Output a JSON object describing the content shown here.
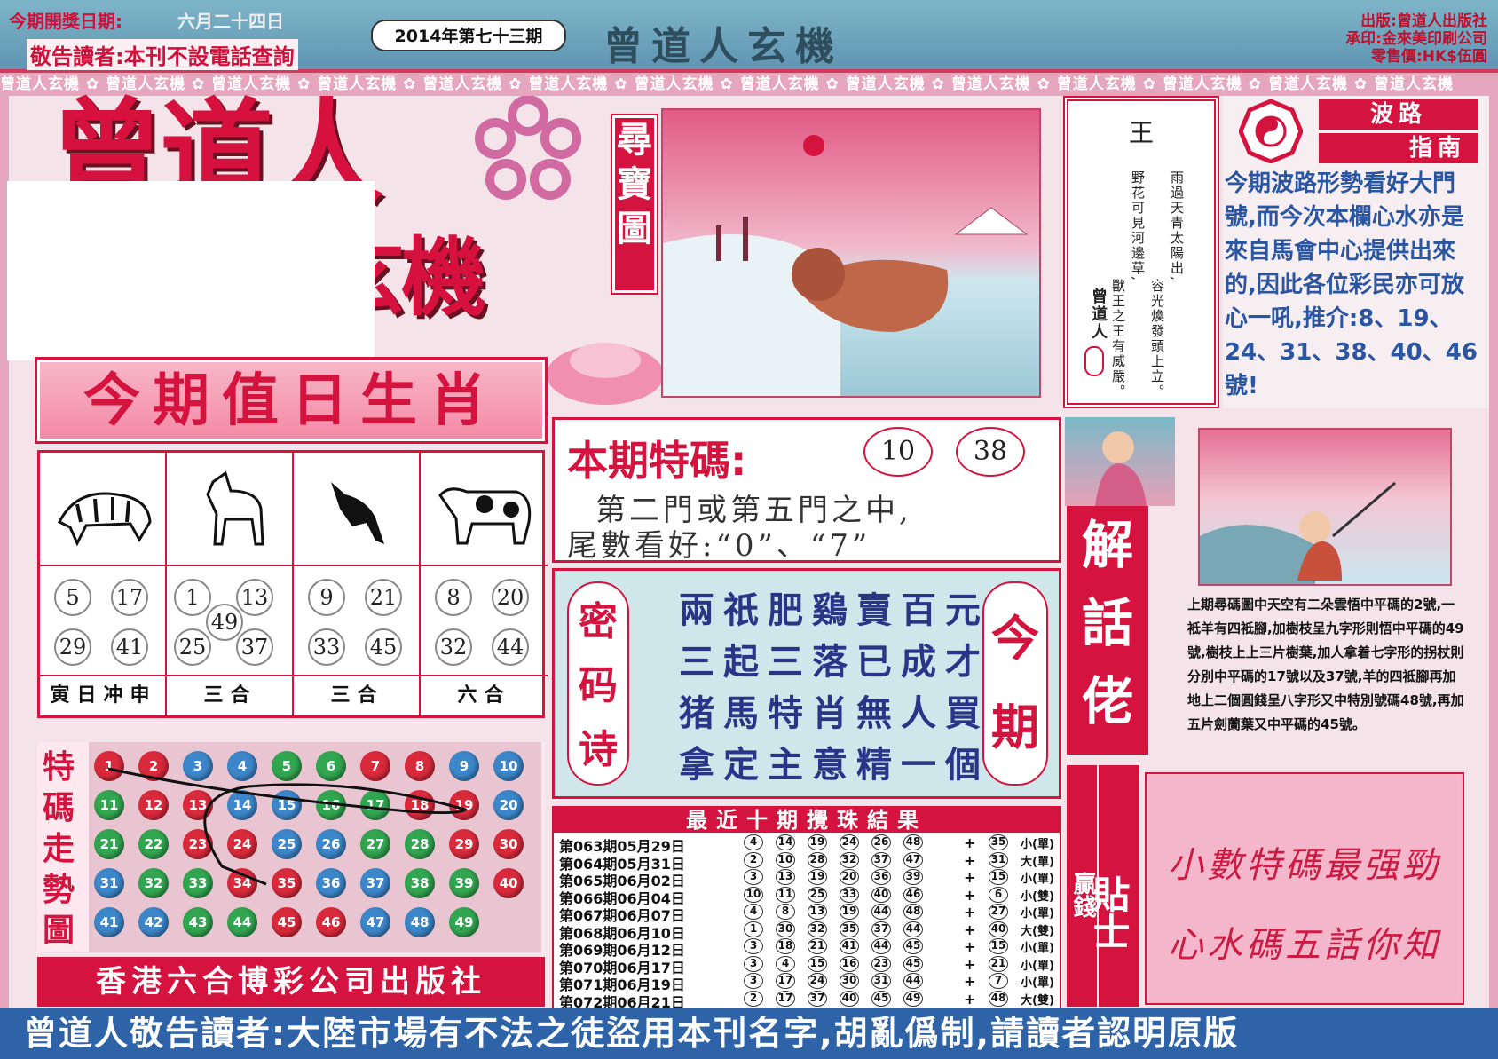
{
  "header": {
    "draw_date_label": "今期開獎日期:",
    "draw_date_value": "六月二十四日",
    "notice": "敬告讀者:本刊不設電話查詢",
    "issue": "2014年第七十三期",
    "title": "曾道人玄機",
    "publisher_lines": [
      "出版:曾道人出版社",
      "承印:金來美印刷公司",
      "零售價:HK$伍圓"
    ]
  },
  "strip_text": "曾道人玄機",
  "masthead": {
    "line1": "曾道人",
    "line2": "玄機"
  },
  "zodiac": {
    "title": "今期值日生肖",
    "columns": [
      {
        "animal": "tiger",
        "numbers": [
          "5",
          "17",
          "29",
          "41"
        ],
        "footer": "寅日冲申"
      },
      {
        "animal": "horse",
        "numbers": [
          "1",
          "13",
          "49",
          "25",
          "37"
        ],
        "footer": "三合"
      },
      {
        "animal": "dog",
        "numbers": [
          "9",
          "21",
          "33",
          "45"
        ],
        "footer": "三合"
      },
      {
        "animal": "ox",
        "numbers": [
          "8",
          "20",
          "32",
          "44"
        ],
        "footer": "六合"
      }
    ]
  },
  "trend": {
    "label": "特碼走勢圖",
    "balls": [
      {
        "n": "1",
        "c": "red"
      },
      {
        "n": "2",
        "c": "red"
      },
      {
        "n": "3",
        "c": "blue"
      },
      {
        "n": "4",
        "c": "blue"
      },
      {
        "n": "5",
        "c": "green"
      },
      {
        "n": "6",
        "c": "green"
      },
      {
        "n": "7",
        "c": "red"
      },
      {
        "n": "8",
        "c": "red"
      },
      {
        "n": "9",
        "c": "blue"
      },
      {
        "n": "10",
        "c": "blue"
      },
      {
        "n": "11",
        "c": "green"
      },
      {
        "n": "12",
        "c": "red"
      },
      {
        "n": "13",
        "c": "red"
      },
      {
        "n": "14",
        "c": "blue"
      },
      {
        "n": "15",
        "c": "blue"
      },
      {
        "n": "16",
        "c": "green"
      },
      {
        "n": "17",
        "c": "green"
      },
      {
        "n": "18",
        "c": "red"
      },
      {
        "n": "19",
        "c": "red"
      },
      {
        "n": "20",
        "c": "blue"
      },
      {
        "n": "21",
        "c": "green"
      },
      {
        "n": "22",
        "c": "green"
      },
      {
        "n": "23",
        "c": "red"
      },
      {
        "n": "24",
        "c": "red"
      },
      {
        "n": "25",
        "c": "blue"
      },
      {
        "n": "26",
        "c": "blue"
      },
      {
        "n": "27",
        "c": "green"
      },
      {
        "n": "28",
        "c": "green"
      },
      {
        "n": "29",
        "c": "red"
      },
      {
        "n": "30",
        "c": "red"
      },
      {
        "n": "31",
        "c": "blue"
      },
      {
        "n": "32",
        "c": "green"
      },
      {
        "n": "33",
        "c": "green"
      },
      {
        "n": "34",
        "c": "red"
      },
      {
        "n": "35",
        "c": "red"
      },
      {
        "n": "36",
        "c": "blue"
      },
      {
        "n": "37",
        "c": "blue"
      },
      {
        "n": "38",
        "c": "green"
      },
      {
        "n": "39",
        "c": "green"
      },
      {
        "n": "40",
        "c": "red"
      },
      {
        "n": "41",
        "c": "blue"
      },
      {
        "n": "42",
        "c": "blue"
      },
      {
        "n": "43",
        "c": "green"
      },
      {
        "n": "44",
        "c": "green"
      },
      {
        "n": "45",
        "c": "red"
      },
      {
        "n": "46",
        "c": "red"
      },
      {
        "n": "47",
        "c": "blue"
      },
      {
        "n": "48",
        "c": "blue"
      },
      {
        "n": "49",
        "c": "green"
      }
    ]
  },
  "publisher": "香港六合博彩公司出版社",
  "xunbao_label": "尋寶圖",
  "special": {
    "title": "本期特碼:",
    "numbers": [
      "10",
      "38"
    ],
    "line1": "第二門或第五門之中,",
    "line2": "尾數看好:“0”、“7”"
  },
  "poem": {
    "left_label": "密码诗",
    "right_label": "今期",
    "lines": [
      "兩祇肥鷄賣百元",
      "三起三落已成才",
      "猪馬特肖無人買",
      "拿定主意精一個"
    ]
  },
  "results": {
    "title": "最近十期攪珠結果",
    "rows": [
      {
        "period": "第063期05月29日",
        "nums": [
          "4",
          "14",
          "19",
          "24",
          "26",
          "48"
        ],
        "special": "35",
        "tag": "小(單)"
      },
      {
        "period": "第064期05月31日",
        "nums": [
          "2",
          "10",
          "28",
          "32",
          "37",
          "47"
        ],
        "special": "31",
        "tag": "大(單)"
      },
      {
        "period": "第065期06月02日",
        "nums": [
          "3",
          "13",
          "19",
          "20",
          "36",
          "39"
        ],
        "special": "15",
        "tag": "小(單)"
      },
      {
        "period": "第066期06月04日",
        "nums": [
          "10",
          "11",
          "25",
          "33",
          "40",
          "46"
        ],
        "special": "6",
        "tag": "小(雙)"
      },
      {
        "period": "第067期06月07日",
        "nums": [
          "4",
          "8",
          "13",
          "19",
          "44",
          "48"
        ],
        "special": "27",
        "tag": "小(單)"
      },
      {
        "period": "第068期06月10日",
        "nums": [
          "1",
          "30",
          "32",
          "35",
          "37",
          "44"
        ],
        "special": "40",
        "tag": "大(雙)"
      },
      {
        "period": "第069期06月12日",
        "nums": [
          "3",
          "18",
          "21",
          "41",
          "44",
          "45"
        ],
        "special": "15",
        "tag": "小(單)"
      },
      {
        "period": "第070期06月17日",
        "nums": [
          "3",
          "4",
          "15",
          "16",
          "23",
          "45"
        ],
        "special": "21",
        "tag": "小(單)"
      },
      {
        "period": "第071期06月19日",
        "nums": [
          "3",
          "17",
          "24",
          "30",
          "31",
          "44"
        ],
        "special": "7",
        "tag": "小(單)"
      },
      {
        "period": "第072期06月21日",
        "nums": [
          "2",
          "17",
          "37",
          "40",
          "45",
          "49"
        ],
        "special": "48",
        "tag": "大(雙)"
      }
    ]
  },
  "poembox": {
    "head": "王",
    "col1": "雨過天青太陽出,",
    "col2": "容光煥發頭上立。",
    "col3": "野花可見河邊草,",
    "col4": "獸王之王有威嚴。",
    "sign": "曾道人"
  },
  "guide": {
    "label1": "波路",
    "label2": "指南",
    "text": "今期波路形勢看好大門號,而今次本欄心水亦是來自馬會中心提供出來的,因此各位彩民亦可放心一吼,推介:8、19、24、31、38、40、46號!"
  },
  "jiehua_label": "解話佬",
  "explain": "上期尋碼圖中天空有二朵雲悟中平碼的2號,一袛羊有四袛腳,加樹枝呈九字形則悟中平碼的49號,樹枝上上三片樹葉,加人拿着七字形的拐杖則分別中平碼的17號以及37號,羊的四袛腳再加地上二個圓錢呈八字形又中特別號碼48號,再加五片劍蘭葉又中平碼的45號。",
  "tie": {
    "small": "贏錢",
    "big": "貼士"
  },
  "tips": [
    "小數特碼最强勁",
    "心水碼五話你知"
  ],
  "footer": "曾道人敬告讀者:大陸市場有不法之徒盜用本刊名字,胡亂僞制,請讀者認明原版"
}
